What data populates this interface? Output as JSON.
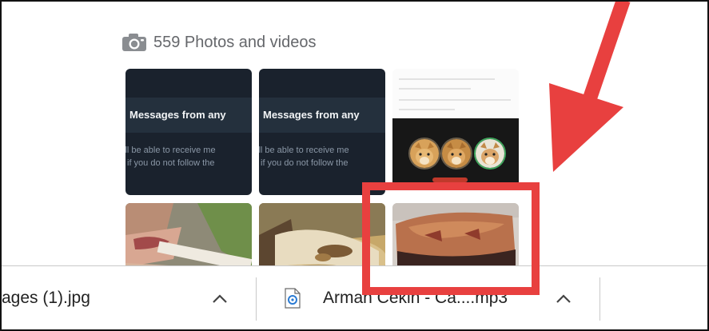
{
  "media": {
    "header_icon": "camera-icon",
    "header_label": "559 Photos and videos",
    "tiles": [
      {
        "kind": "screenshot",
        "title": "Messages from any",
        "line1": "ill be able to receive me",
        "line2": "if you do not follow the"
      },
      {
        "kind": "screenshot",
        "title": "Messages from any",
        "line1": "ill be able to receive me",
        "line2": "if you do not follow the"
      },
      {
        "kind": "screenshot",
        "content": "three shiba inu avatars"
      },
      {
        "kind": "photo",
        "content": "hand holding cigarette"
      },
      {
        "kind": "photo",
        "content": "food on plate"
      },
      {
        "kind": "photo",
        "content": "baked pastry"
      }
    ]
  },
  "downloads": {
    "items": [
      {
        "name": "ages (1).jpg",
        "icon": "none"
      },
      {
        "name": "Arman Cekin - Ca....mp3",
        "icon": "audio-file-icon"
      }
    ],
    "menu_icon": "chevron-up-icon"
  },
  "annotation": {
    "color": "#e8403f",
    "elements": [
      "arrow",
      "highlight-box"
    ]
  }
}
